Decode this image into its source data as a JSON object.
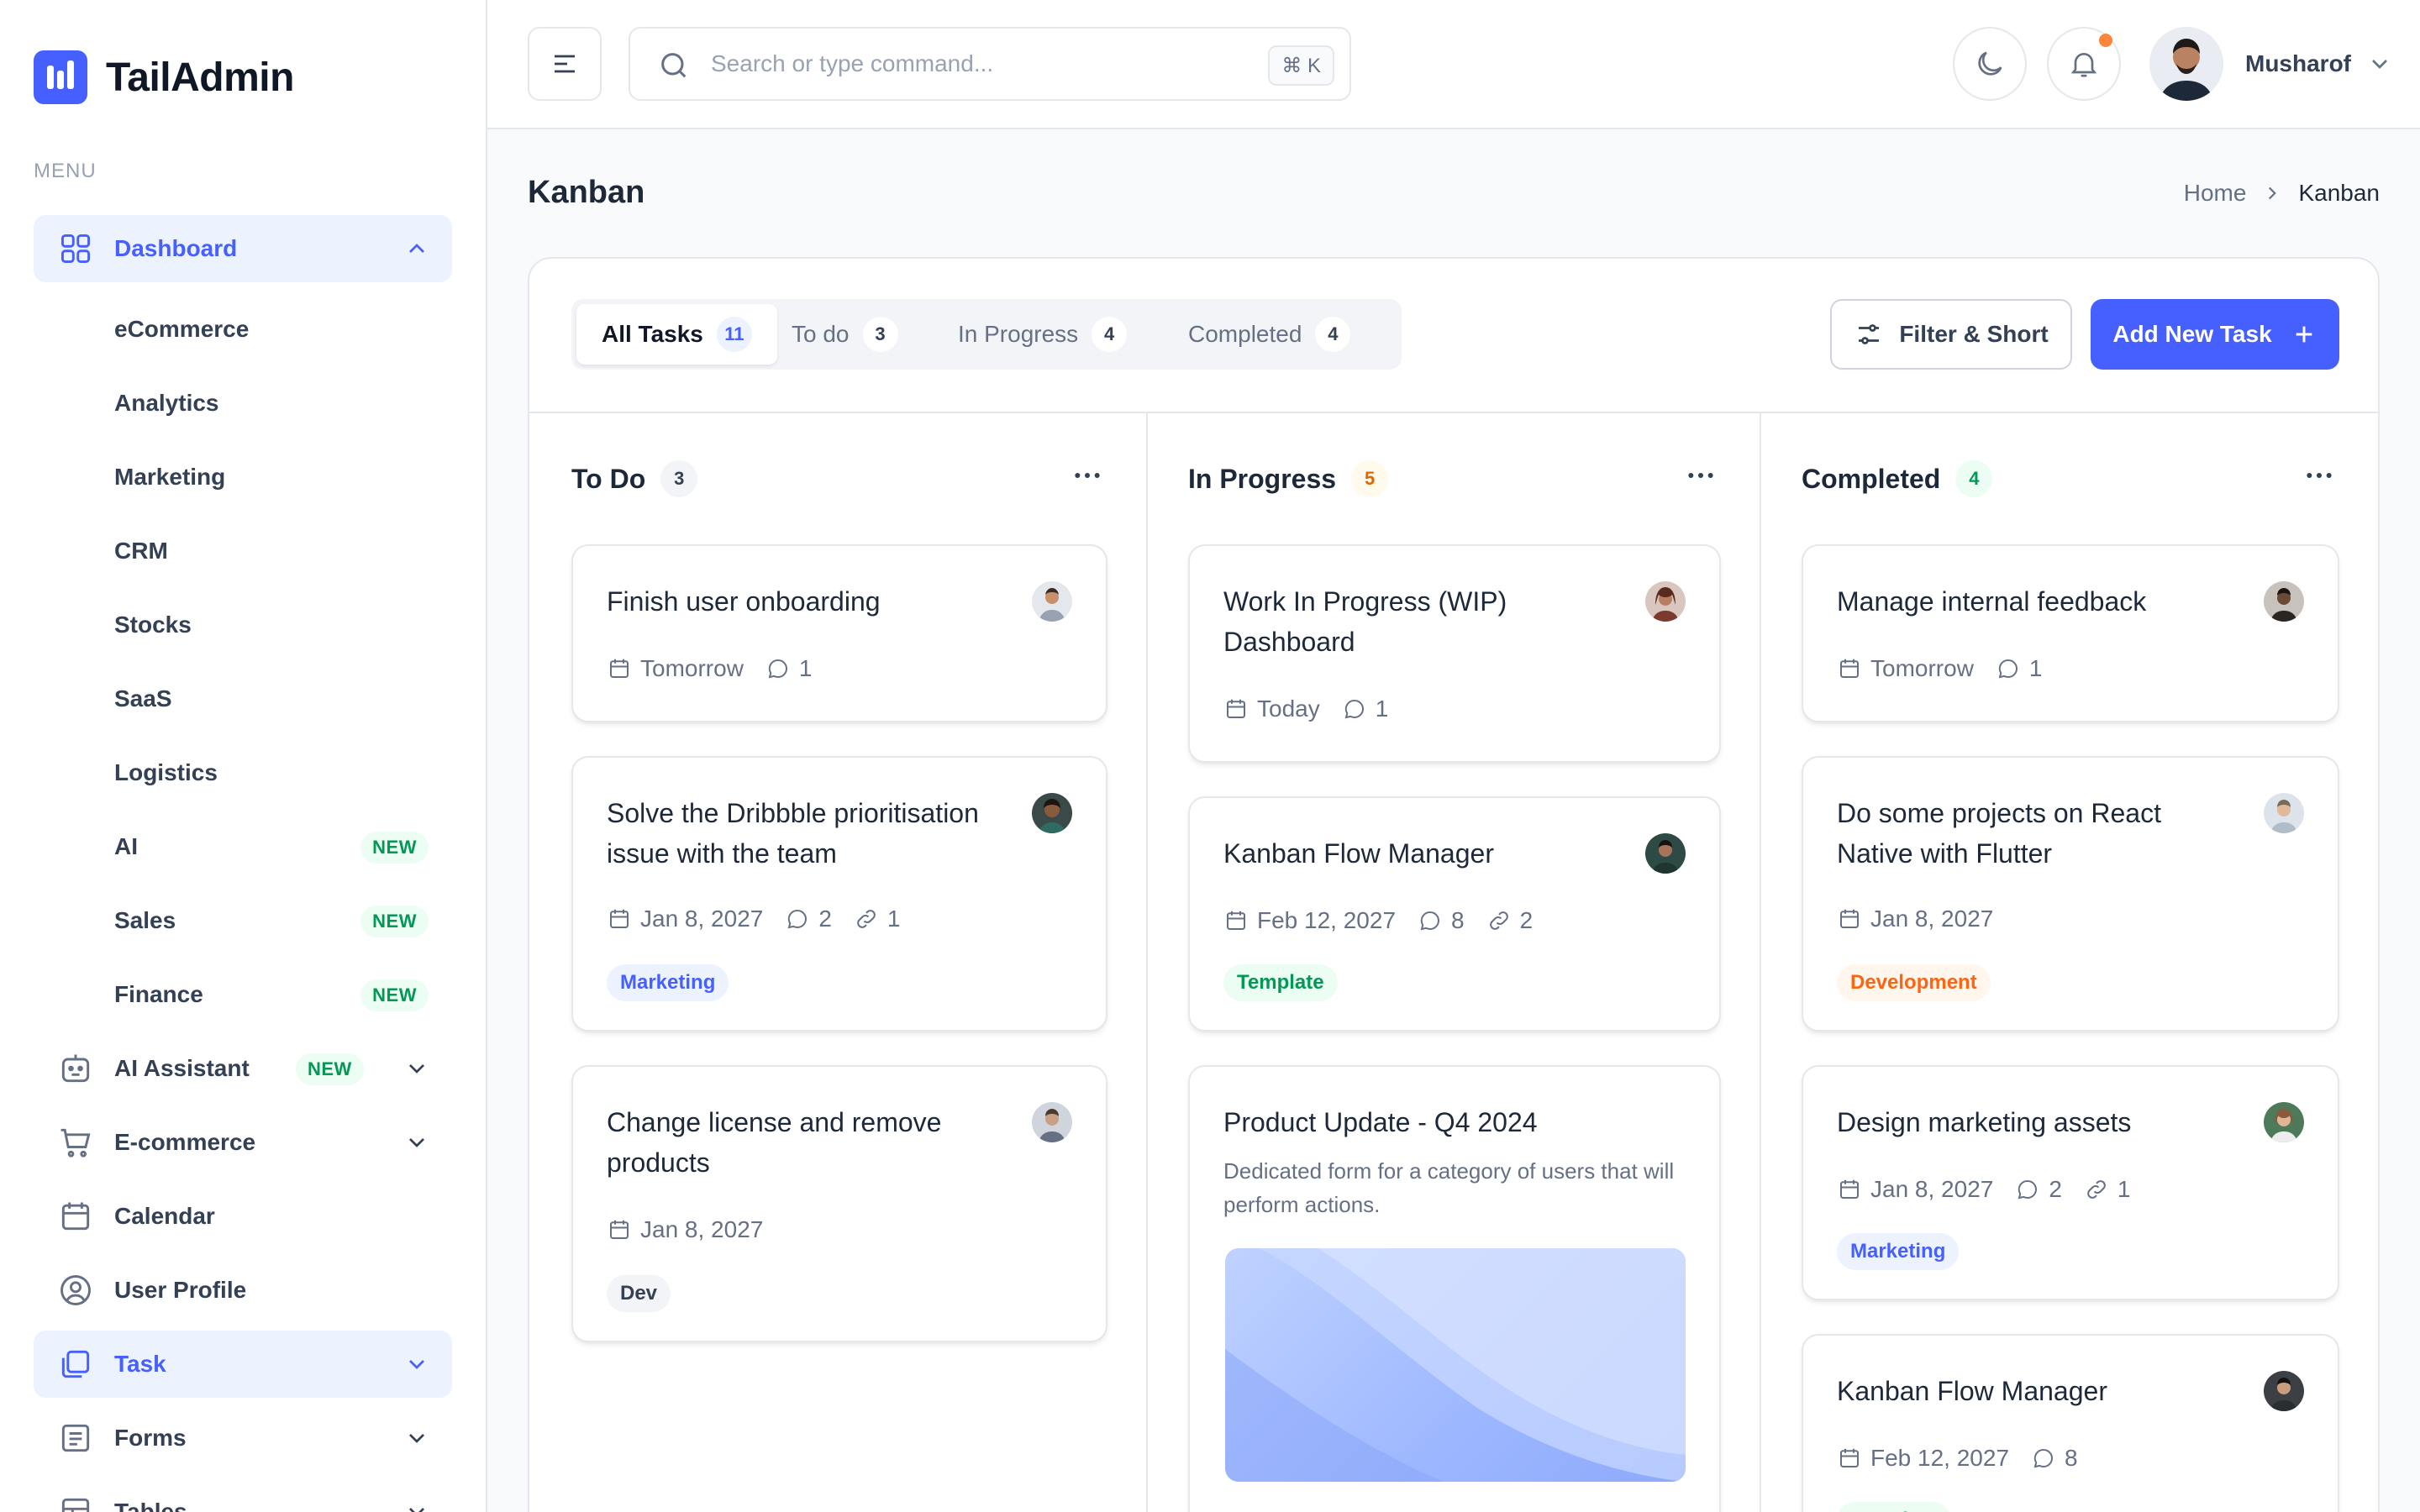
{
  "app": {
    "name": "TailAdmin"
  },
  "sidebar": {
    "menu_label": "MENU",
    "dashboard": {
      "label": "Dashboard"
    },
    "dashboard_items": [
      {
        "label": "eCommerce"
      },
      {
        "label": "Analytics"
      },
      {
        "label": "Marketing"
      },
      {
        "label": "CRM"
      },
      {
        "label": "Stocks"
      },
      {
        "label": "SaaS"
      },
      {
        "label": "Logistics"
      },
      {
        "label": "AI",
        "badge": "NEW"
      },
      {
        "label": "Sales",
        "badge": "NEW"
      },
      {
        "label": "Finance",
        "badge": "NEW"
      }
    ],
    "items": [
      {
        "label": "AI Assistant",
        "badge": "NEW",
        "icon": "robot-icon"
      },
      {
        "label": "E-commerce",
        "icon": "cart-icon"
      },
      {
        "label": "Calendar",
        "icon": "calendar-icon"
      },
      {
        "label": "User Profile",
        "icon": "user-circle-icon"
      },
      {
        "label": "Task",
        "icon": "task-icon"
      },
      {
        "label": "Forms",
        "icon": "form-icon"
      },
      {
        "label": "Tables",
        "icon": "table-icon"
      }
    ]
  },
  "header": {
    "search_placeholder": "Search or type command...",
    "shortcut": "⌘ K",
    "user_name": "Musharof"
  },
  "page": {
    "title": "Kanban",
    "breadcrumb_home": "Home",
    "breadcrumb_current": "Kanban"
  },
  "tabs": [
    {
      "label": "All Tasks",
      "count": "11"
    },
    {
      "label": "To do",
      "count": "3"
    },
    {
      "label": "In Progress",
      "count": "4"
    },
    {
      "label": "Completed",
      "count": "4"
    }
  ],
  "actions": {
    "filter": "Filter & Short",
    "add_task": "Add New Task"
  },
  "colors": {
    "primary": "#465FFF",
    "success": "#039855",
    "warning": "#FB6514",
    "notification": "#FD853A"
  },
  "columns": [
    {
      "title": "To Do",
      "count": "3",
      "cards": [
        {
          "title": "Finish user onboarding",
          "date": "Tomorrow",
          "comments": "1"
        },
        {
          "title": "Solve the Dribbble prioritisation issue with the team",
          "date": "Jan 8, 2027",
          "comments": "2",
          "links": "1",
          "tag": "Marketing"
        },
        {
          "title": "Change license and remove products",
          "date": "Jan 8, 2027",
          "tag": "Dev"
        }
      ]
    },
    {
      "title": "In Progress",
      "count": "5",
      "cards": [
        {
          "title": "Work In Progress (WIP) Dashboard",
          "date": "Today",
          "comments": "1"
        },
        {
          "title": "Kanban Flow Manager",
          "date": "Feb 12, 2027",
          "comments": "8",
          "links": "2",
          "tag": "Template"
        },
        {
          "title": "Product Update - Q4 2024",
          "description": "Dedicated form for a category of users that will perform actions."
        }
      ]
    },
    {
      "title": "Completed",
      "count": "4",
      "cards": [
        {
          "title": "Manage internal feedback",
          "date": "Tomorrow",
          "comments": "1"
        },
        {
          "title": "Do some projects on React Native with Flutter",
          "date": "Jan 8, 2027",
          "tag": "Development"
        },
        {
          "title": "Design marketing assets",
          "date": "Jan 8, 2027",
          "comments": "2",
          "links": "1",
          "tag": "Marketing"
        },
        {
          "title": "Kanban Flow Manager",
          "date": "Feb 12, 2027",
          "comments": "8",
          "tag": "Template"
        }
      ]
    }
  ]
}
